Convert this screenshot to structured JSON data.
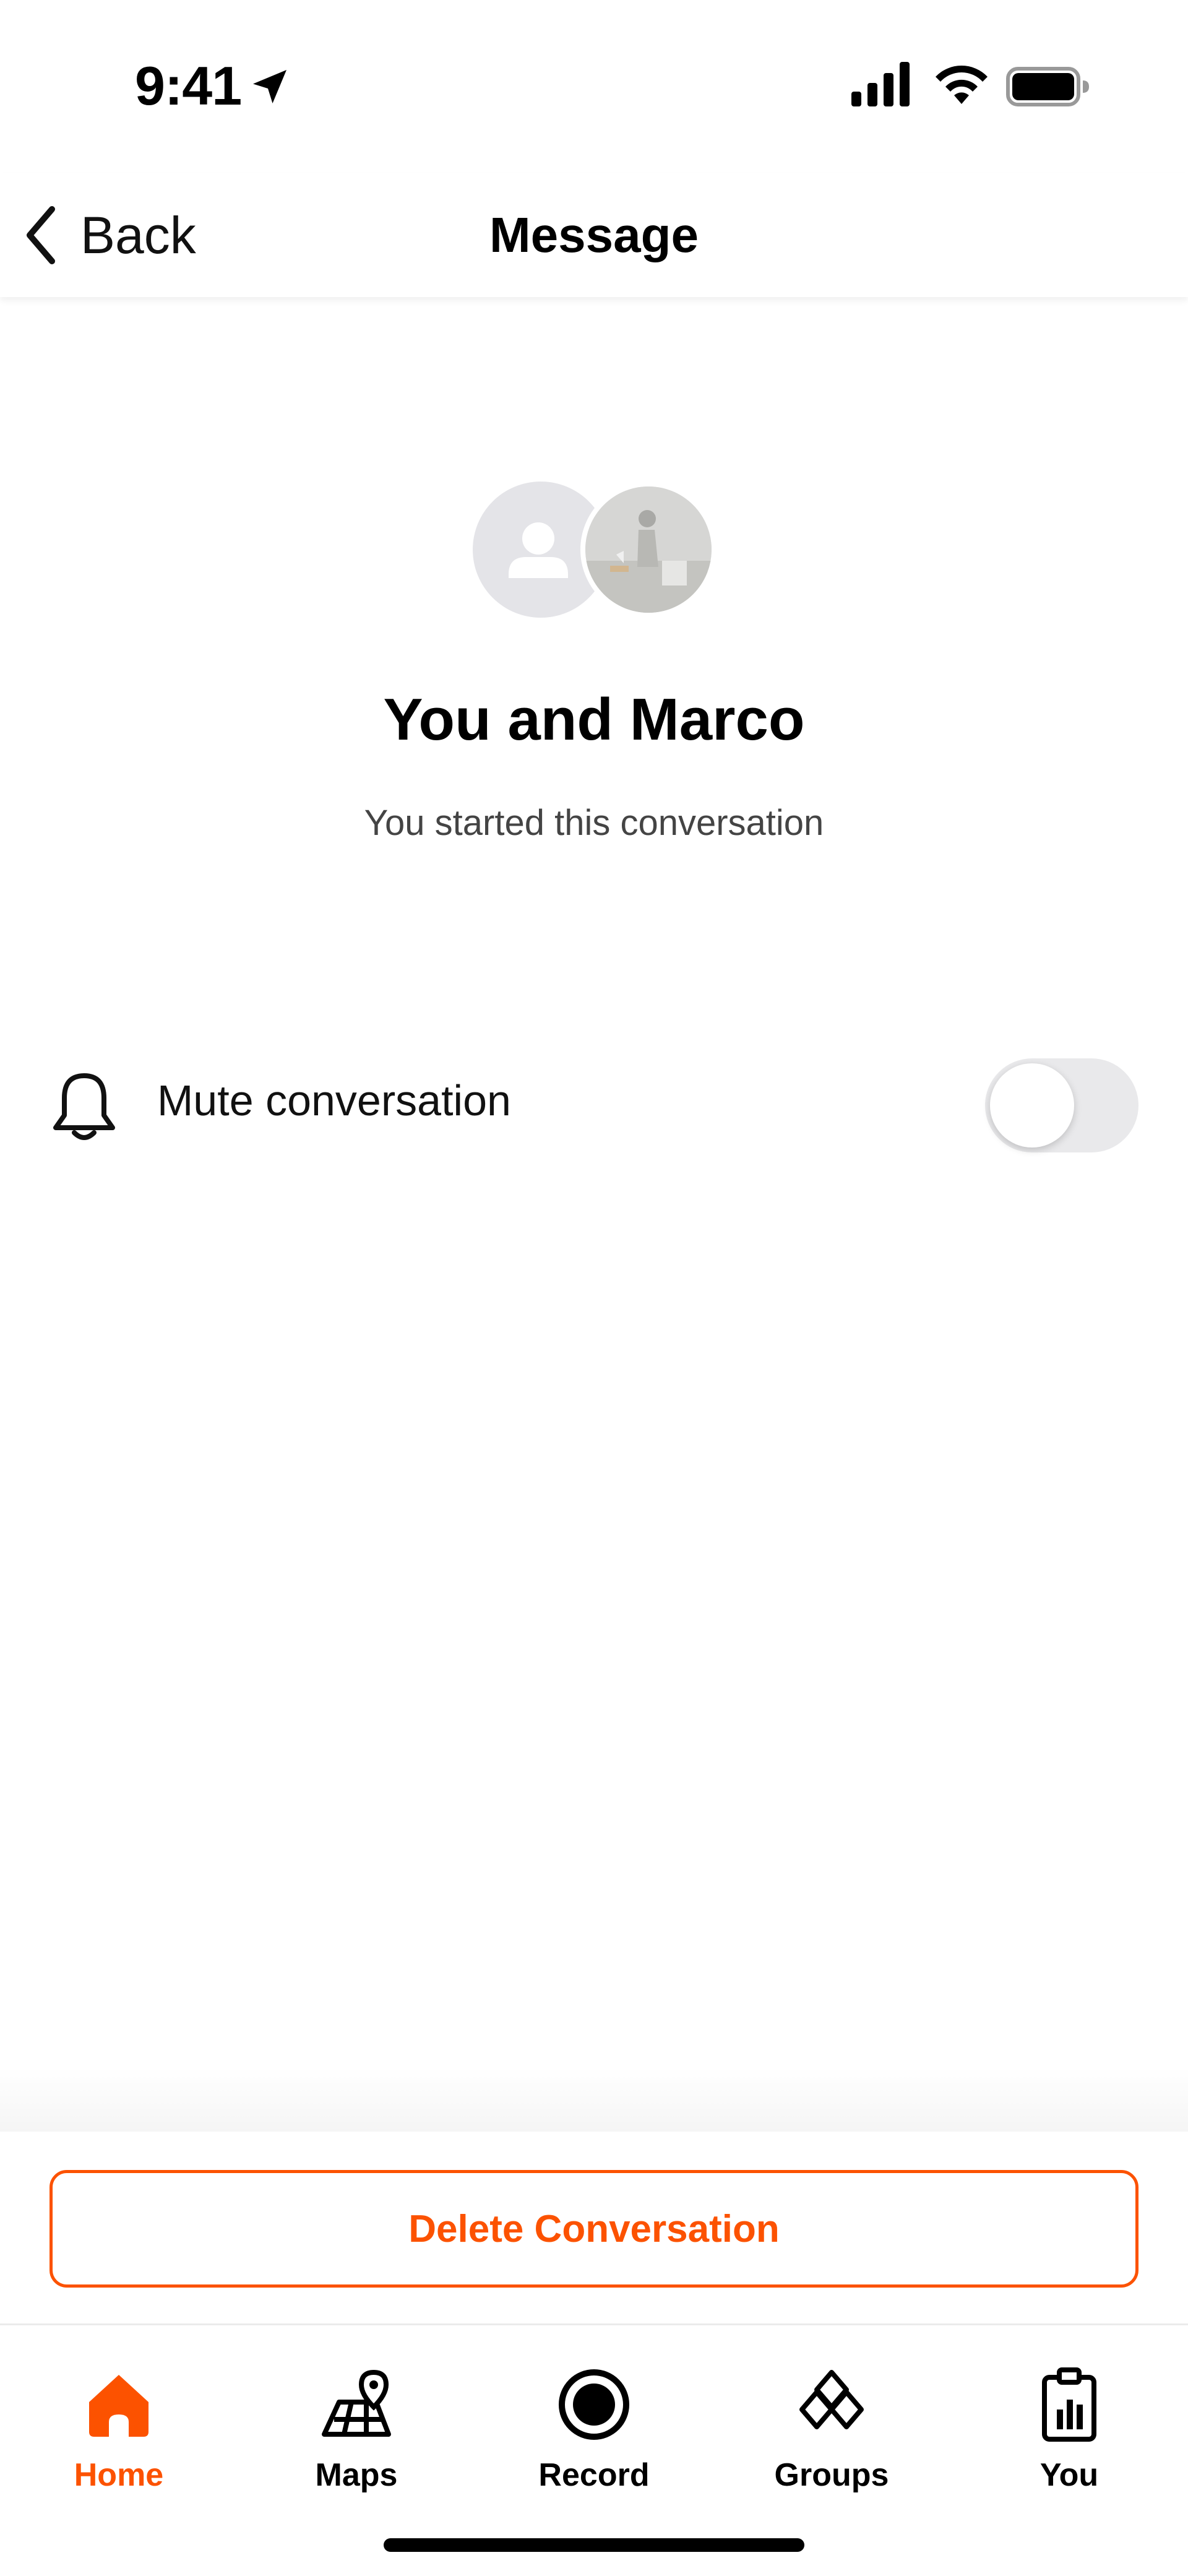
{
  "status_bar": {
    "time": "9:41"
  },
  "nav": {
    "back_label": "Back",
    "title": "Message"
  },
  "conversation": {
    "title": "You and Marco",
    "subtitle": "You started this conversation"
  },
  "settings": {
    "mute_label": "Mute conversation",
    "mute_enabled": false
  },
  "actions": {
    "delete_label": "Delete Conversation"
  },
  "tab_bar": {
    "active": "Home",
    "tabs": [
      {
        "label": "Home",
        "icon": "home-icon"
      },
      {
        "label": "Maps",
        "icon": "maps-icon"
      },
      {
        "label": "Record",
        "icon": "record-icon"
      },
      {
        "label": "Groups",
        "icon": "groups-icon"
      },
      {
        "label": "You",
        "icon": "you-icon"
      }
    ]
  },
  "colors": {
    "accent": "#fc5200",
    "toggle_off": "#e9e9eb",
    "avatar_bg": "#e4e4e8"
  }
}
